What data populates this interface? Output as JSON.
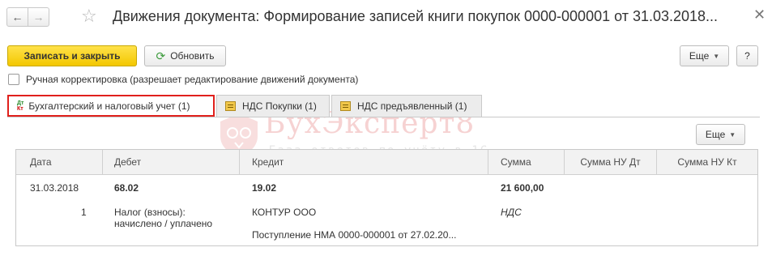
{
  "window": {
    "title": "Движения документа: Формирование записей книги покупок 0000-000001 от 31.03.2018..."
  },
  "toolbar": {
    "save_close_label": "Записать и закрыть",
    "refresh_label": "Обновить",
    "more_label": "Еще",
    "help_label": "?"
  },
  "manual_correction": {
    "label": "Ручная корректировка (разрешает редактирование движений документа)",
    "checked": false
  },
  "tabs": [
    {
      "label": "Бухгалтерский и налоговый учет (1)",
      "icon": "dt-kt-icon",
      "active": true
    },
    {
      "label": "НДС Покупки (1)",
      "icon": "register-icon",
      "active": false
    },
    {
      "label": "НДС предъявленный (1)",
      "icon": "register-icon",
      "active": false
    }
  ],
  "tab_toolbar": {
    "more_label": "Еще"
  },
  "watermark": {
    "title": "БухЭксперт8",
    "subtitle": "База ответов по учёту в 1С"
  },
  "table": {
    "columns": [
      "Дата",
      "Дебет",
      "Кредит",
      "Сумма",
      "Сумма НУ Дт",
      "Сумма НУ Кт"
    ],
    "row": {
      "date": "31.03.2018",
      "line_no": "1",
      "debit_account": "68.02",
      "debit_subconto1": "Налог (взносы):",
      "debit_subconto2": "начислено / уплачено",
      "credit_account": "19.02",
      "credit_subconto1": "КОНТУР ООО",
      "credit_subconto2": "Поступление НМА 0000-000001 от 27.02.20...",
      "amount": "21 600,00",
      "amount_note": "НДС",
      "nu_dt": "",
      "nu_kt": ""
    }
  },
  "colors": {
    "primary_button": "#f3c700",
    "active_tab_border": "#e0201c",
    "watermark": "#f6d2d2"
  }
}
